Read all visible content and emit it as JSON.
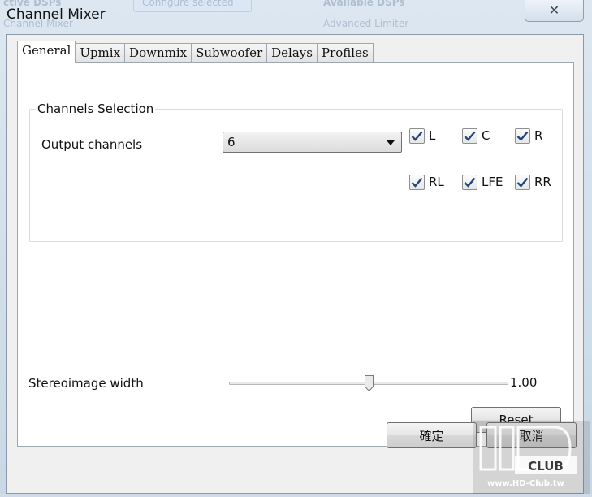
{
  "window": {
    "title": "Channel Mixer",
    "close_glyph": "✕"
  },
  "background_ghost": {
    "line1_left": "ctive DSPs",
    "line2_left": "Channel Mixer",
    "button": "Configure selected",
    "line1_right": "Available DSPs",
    "line2_right": "Advanced Limiter"
  },
  "tabs": [
    {
      "label": "General",
      "active": true
    },
    {
      "label": "Upmix",
      "active": false
    },
    {
      "label": "Downmix",
      "active": false
    },
    {
      "label": "Subwoofer",
      "active": false
    },
    {
      "label": "Delays",
      "active": false
    },
    {
      "label": "Profiles",
      "active": false
    }
  ],
  "channels_selection": {
    "group_label": "Channels Selection",
    "output_label": "Output channels",
    "output_value": "6",
    "channels": [
      {
        "label": "L",
        "checked": true
      },
      {
        "label": "C",
        "checked": true
      },
      {
        "label": "R",
        "checked": true
      },
      {
        "label": "RL",
        "checked": true
      },
      {
        "label": "LFE",
        "checked": true
      },
      {
        "label": "RR",
        "checked": true
      }
    ]
  },
  "stereo_width": {
    "label": "Stereoimage width",
    "value_text": "1.00",
    "slider_fraction": 0.5
  },
  "buttons": {
    "reset": "Reset",
    "ok": "確定",
    "cancel": "取消"
  },
  "watermark": {
    "text": "www.HD-Club.tw"
  }
}
